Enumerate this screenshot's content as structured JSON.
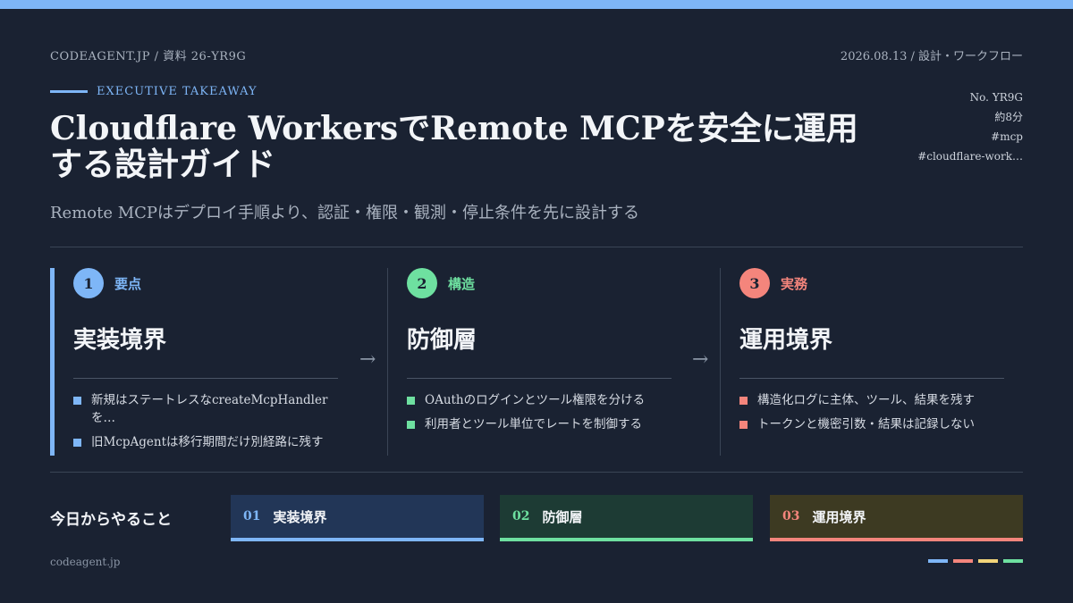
{
  "header": {
    "left": "CODEAGENT.JP / 資料 26-YR9G",
    "right": "2026.08.13 / 設計・ワークフロー"
  },
  "eyebrow": "EXECUTIVE TAKEAWAY",
  "sidemeta": [
    "No. YR9G",
    "約8分",
    "#mcp",
    "#cloudflare-work…"
  ],
  "title": "Cloudflare WorkersでRemote MCPを安全に運用する設計ガイド",
  "subtitle": "Remote MCPはデプロイ手順より、認証・権限・観測・停止条件を先に設計する",
  "columns": [
    {
      "number": "1",
      "label": "要点",
      "title": "実装境界",
      "items": [
        "新規はステートレスなcreateMcpHandlerを…",
        "旧McpAgentは移行期間だけ別経路に残す"
      ]
    },
    {
      "number": "2",
      "label": "構造",
      "title": "防御層",
      "items": [
        "OAuthのログインとツール権限を分ける",
        "利用者とツール単位でレートを制御する"
      ]
    },
    {
      "number": "3",
      "label": "実務",
      "title": "運用境界",
      "items": [
        "構造化ログに主体、ツール、結果を残す",
        "トークンと機密引数・結果は記録しない"
      ]
    }
  ],
  "arrow_glyph": "→",
  "today": {
    "label": "今日からやること",
    "actions": [
      {
        "num": "01",
        "text": "実装境界"
      },
      {
        "num": "02",
        "text": "防御層"
      },
      {
        "num": "03",
        "text": "運用境界"
      }
    ]
  },
  "footer": "codeagent.jp",
  "colors": {
    "blue": "#7eb6f7",
    "green": "#6ee0a0",
    "red": "#f4857c",
    "yellow": "#f2d479",
    "background": "#1a2232"
  }
}
